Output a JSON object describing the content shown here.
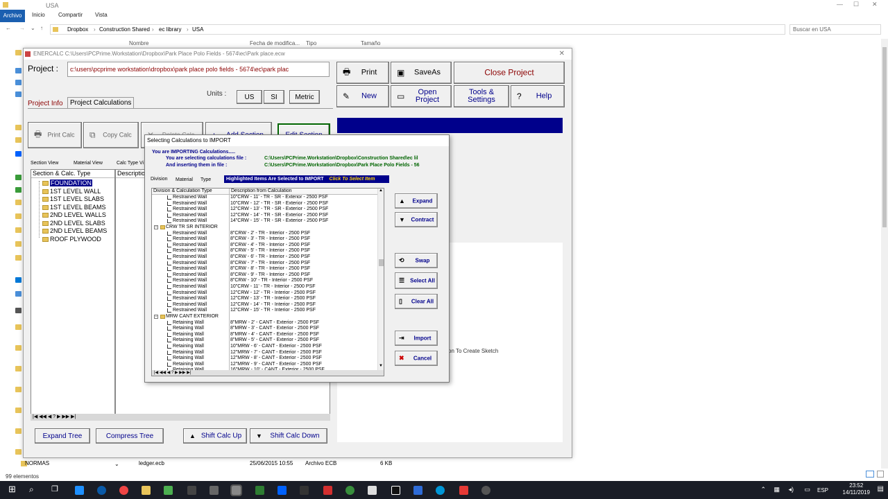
{
  "explorer": {
    "title": "USA",
    "ribbon": {
      "file": "Archivo",
      "home": "Inicio",
      "share": "Compartir",
      "view": "Vista"
    },
    "breadcrumb": [
      "Dropbox",
      "Construction Shared",
      "ec library",
      "USA"
    ],
    "search_placeholder": "Buscar en USA",
    "columns": {
      "name": "Nombre",
      "date": "Fecha de modifica...",
      "type": "Tipo",
      "size": "Tamaño"
    },
    "rows": [
      {
        "name": "NORMAS"
      },
      {
        "name": "ledger.ecb",
        "date": "25/06/2015 10:55",
        "type": "Archivo ECB",
        "size": "6 KB"
      }
    ],
    "status": "99 elementos"
  },
  "enercalc": {
    "title": "ENERCALC C:\\Users\\PCPrime.Workstation\\Dropbox\\Park Place Polo Fields - 5674\\ec\\Park place.ecw",
    "project_label": "Project :",
    "project_path": "c:\\users\\pcprime workstation\\dropbox\\park place polo fields - 5674\\ec\\park plac",
    "buttons": {
      "print": "Print",
      "saveas": "SaveAs",
      "close_project": "Close Project",
      "new": "New",
      "open_project": "Open Project",
      "tools_settings": "Tools & Settings",
      "help": "Help",
      "print_calc": "Print Calc",
      "copy_calc": "Copy Calc",
      "delete_calc": "Delete Calc",
      "add_section": "Add Section",
      "edit_section": "Edit Section",
      "expand_tree": "Expand Tree",
      "compress_tree": "Compress Tree",
      "shift_up": "Shift Calc Up",
      "shift_down": "Shift Calc Down"
    },
    "units_label": "Units :",
    "units": [
      "US",
      "SI",
      "Metric"
    ],
    "tabs": [
      "Project Info",
      "Project Calculations"
    ],
    "view_tabs": [
      "Section View",
      "Material View",
      "Calc Type Vi"
    ],
    "tree_header": "Section & Calc. Type",
    "desc_header": "Descriptio",
    "sections": [
      "FOUNDATION",
      "1ST LEVEL WALL",
      "1ST LEVEL SLABS",
      "1ST LEVEL BEAMS",
      "2ND LEVEL WALLS",
      "2ND LEVEL SLABS",
      "2ND LEVEL BEAMS",
      "ROOF PLYWOOD"
    ],
    "sketch_hint": "on To Create Sketch",
    "nav": "|◀ ◀◀ ◀ ? ▶ ▶▶ ▶|"
  },
  "dialog": {
    "title": "Selecting Calculations to IMPORT",
    "importing": "You are IMPORTING Calculations.....",
    "selecting_label": "You are selecting calculations file :",
    "selecting_value": "C:\\Users\\PCPrime.Workstation\\Dropbox\\Construction Shared\\ec lil",
    "inserting_label": "And inserting them in file :",
    "inserting_value": "C:\\Users\\PCPrime.Workstation\\Dropbox\\Park Place Polo Fields - 56",
    "highlight": "Highlighted Items Are Selected to IMPORT",
    "click_hint": "Click To Select Item",
    "tabs": [
      "Division",
      "Material",
      "Type"
    ],
    "col1": "Division & Calculation Type",
    "col2": "Description from Calculation",
    "rows": [
      {
        "t": "Restrained Wall",
        "d": "10\"CRW - 11' - TR - SR - Exterior - 2500 PSF"
      },
      {
        "t": "Restrained Wall",
        "d": "10\"CRW - 12' - TR - SR - Exterior - 2500 PSF"
      },
      {
        "t": "Restrained Wall",
        "d": "12\"CRW - 13' - TR - SR - Exterior - 2500 PSF"
      },
      {
        "t": "Restrained Wall",
        "d": "12\"CRW - 14' - TR - SR - Exterior - 2500 PSF"
      },
      {
        "t": "Restrained Wall",
        "d": "14\"CRW - 15' - TR - SR - Exterior - 2500 PSF"
      },
      {
        "g": "CRW TR SR INTERIOR"
      },
      {
        "t": "Restrained Wall",
        "d": "8\"CRW - 2' - TR - Interior - 2500 PSF"
      },
      {
        "t": "Restrained Wall",
        "d": "8\"CRW - 3' - TR - Interior - 2500 PSF"
      },
      {
        "t": "Restrained Wall",
        "d": "8\"CRW - 4' - TR - Interior - 2500 PSF"
      },
      {
        "t": "Restrained Wall",
        "d": "8\"CRW - 5' - TR - Interior - 2500 PSF"
      },
      {
        "t": "Restrained Wall",
        "d": "8\"CRW - 6' - TR - Interior - 2500 PSF"
      },
      {
        "t": "Restrained Wall",
        "d": "8\"CRW - 7' - TR - Interior - 2500 PSF"
      },
      {
        "t": "Restrained Wall",
        "d": "8\"CRW - 8' - TR - Interior - 2500 PSF"
      },
      {
        "t": "Restrained Wall",
        "d": "8\"CRW - 9' - TR - Interior - 2500 PSF"
      },
      {
        "t": "Restrained Wall",
        "d": "8\"CRW - 10' - TR - Interior - 2500 PSF"
      },
      {
        "t": "Restrained Wall",
        "d": "10\"CRW - 11' - TR - Interior - 2500 PSF"
      },
      {
        "t": "Restrained Wall",
        "d": "12\"CRW - 12' - TR - Interior - 2500 PSF"
      },
      {
        "t": "Restrained Wall",
        "d": "12\"CRW - 13' - TR - Interior - 2500 PSF"
      },
      {
        "t": "Restrained Wall",
        "d": "12\"CRW - 14' - TR - Interior - 2500 PSF"
      },
      {
        "t": "Restrained Wall",
        "d": "12\"CRW - 15' - TR - Interior - 2500 PSF"
      },
      {
        "g": "MRW CANT EXTERIOR"
      },
      {
        "t": "Retaining Wall",
        "d": "8\"MRW - 2' - CANT - Exterior - 2500 PSF"
      },
      {
        "t": "Retaining Wall",
        "d": "8\"MRW - 3' - CANT - Exterior - 2500 PSF"
      },
      {
        "t": "Retaining Wall",
        "d": "8\"MRW - 4' - CANT - Exterior - 2500 PSF"
      },
      {
        "t": "Retaining Wall",
        "d": "8\"MRW - 5' - CANT - Exterior - 2500 PSF"
      },
      {
        "t": "Retaining Wall",
        "d": "10\"MRW - 6' - CANT - Exterior - 2500 PSF"
      },
      {
        "t": "Retaining Wall",
        "d": "12\"MRW - 7' - CANT - Exterior - 2500 PSF"
      },
      {
        "t": "Retaining Wall",
        "d": "12\"MRW - 8' - CANT - Exterior - 2500 PSF"
      },
      {
        "t": "Retaining Wall",
        "d": "12\"MRW - 9' - CANT - Exterior - 2500 PSF"
      },
      {
        "t": "Retaining Wall",
        "d": "16\"MRW - 10' - CANT - Exterior - 2500 PSF"
      }
    ],
    "buttons": {
      "expand": "Expand",
      "contract": "Contract",
      "swap": "Swap",
      "select_all": "Select All",
      "clear_all": "Clear All",
      "import": "Import",
      "cancel": "Cancel"
    }
  },
  "taskbar": {
    "lang": "ESP",
    "time": "23:52",
    "date": "14/11/2019"
  }
}
